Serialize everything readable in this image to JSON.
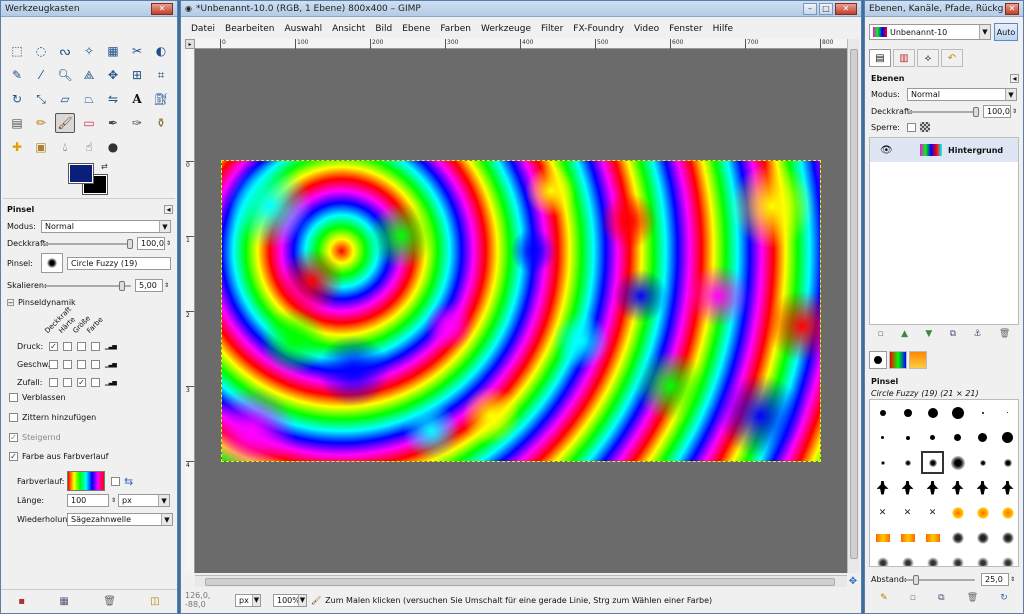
{
  "toolbox": {
    "title": "Werkzeugkasten",
    "tool_options_title": "Pinsel",
    "modus_label": "Modus:",
    "modus_value": "Normal",
    "deckkraft_label": "Deckkraft:",
    "deckkraft_value": "100,0",
    "pinsel_label": "Pinsel:",
    "pinsel_value": "Circle Fuzzy (19)",
    "skalieren_label": "Skalieren:",
    "skalieren_value": "5,00",
    "dynamics_title": "Pinseldynamik",
    "dyn_headers": [
      "Deckkraft",
      "Härte",
      "Größe",
      "Farbe"
    ],
    "dyn_rows": [
      {
        "label": "Druck:",
        "checks": [
          true,
          false,
          false,
          false
        ]
      },
      {
        "label": "Geschw.:",
        "checks": [
          false,
          false,
          false,
          false
        ]
      },
      {
        "label": "Zufall:",
        "checks": [
          false,
          false,
          true,
          false
        ]
      }
    ],
    "verblassen": "Verblassen",
    "zittern": "Zittern hinzufügen",
    "steigernd": "Steigernd",
    "farbe_aus_verlauf": "Farbe aus Farbverlauf",
    "farbverlauf_label": "Farbverlauf:",
    "laenge_label": "Länge:",
    "laenge_value": "100",
    "laenge_unit": "px",
    "wiederholung_label": "Wiederholung:",
    "wiederholung_value": "Sägezahnwelle",
    "fg_color": "#0a1f7a",
    "bg_color": "#000000"
  },
  "image_window": {
    "title": "*Unbenannt-10.0 (RGB, 1 Ebene) 800x400 – GIMP",
    "menu": [
      "Datei",
      "Bearbeiten",
      "Auswahl",
      "Ansicht",
      "Bild",
      "Ebene",
      "Farben",
      "Werkzeuge",
      "Filter",
      "FX-Foundry",
      "Video",
      "Fenster",
      "Hilfe"
    ],
    "ruler_ticks": [
      "0",
      "100",
      "200",
      "300",
      "400",
      "500",
      "600",
      "700",
      "800"
    ],
    "vruler_ticks": [
      "0",
      "1",
      "2",
      "3",
      "4"
    ],
    "coords": "126,0, -88,0",
    "unit": "px",
    "zoom": "100%",
    "status": "Zum Malen klicken (versuchen Sie Umschalt für eine gerade Linie, Strg zum Wählen einer Farbe)"
  },
  "layers_dock": {
    "title": "Ebenen, Kanäle, Pfade, Rückgäng...",
    "image_selector": "Unbenannt-10",
    "auto_button": "Auto",
    "panel_title": "Ebenen",
    "modus_label": "Modus:",
    "modus_value": "Normal",
    "deckkraft_label": "Deckkraft:",
    "deckkraft_value": "100,0",
    "sperre_label": "Sperre:",
    "layer_name": "Hintergrund",
    "brushes_title": "Pinsel",
    "brush_selected": "Circle Fuzzy (19) (21 × 21)",
    "abstand_label": "Abstand:",
    "abstand_value": "25,0"
  }
}
